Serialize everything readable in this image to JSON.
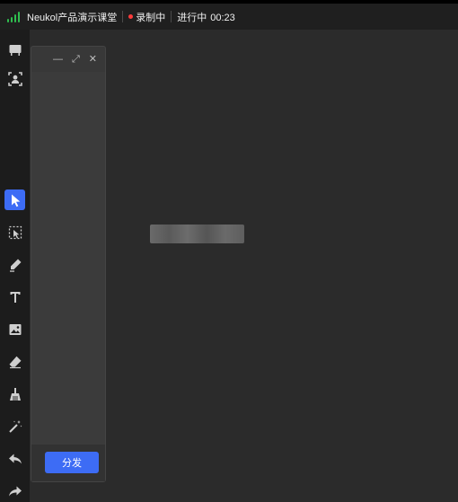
{
  "topbar": {
    "app_title": "Neukol产品演示课堂",
    "recording_label": "录制中",
    "status_label": "进行中",
    "timer": "00:23",
    "signal_color": "#2fbf4f",
    "recording_dot_color": "#ff3b3b"
  },
  "toolbar": {
    "items": [
      {
        "name": "whiteboard-icon"
      },
      {
        "name": "user-frame-icon"
      },
      {
        "name": "cursor-icon",
        "active": true
      },
      {
        "name": "select-icon"
      },
      {
        "name": "pen-icon"
      },
      {
        "name": "text-icon"
      },
      {
        "name": "image-icon"
      },
      {
        "name": "eraser-icon"
      },
      {
        "name": "broom-icon"
      },
      {
        "name": "magic-wand-icon"
      },
      {
        "name": "undo-icon"
      },
      {
        "name": "redo-icon"
      }
    ],
    "active_color": "#3d6cf5"
  },
  "panel": {
    "minimize_glyph": "—",
    "expand_glyph": "⤢",
    "close_glyph": "✕",
    "distribute_label": "分发"
  }
}
